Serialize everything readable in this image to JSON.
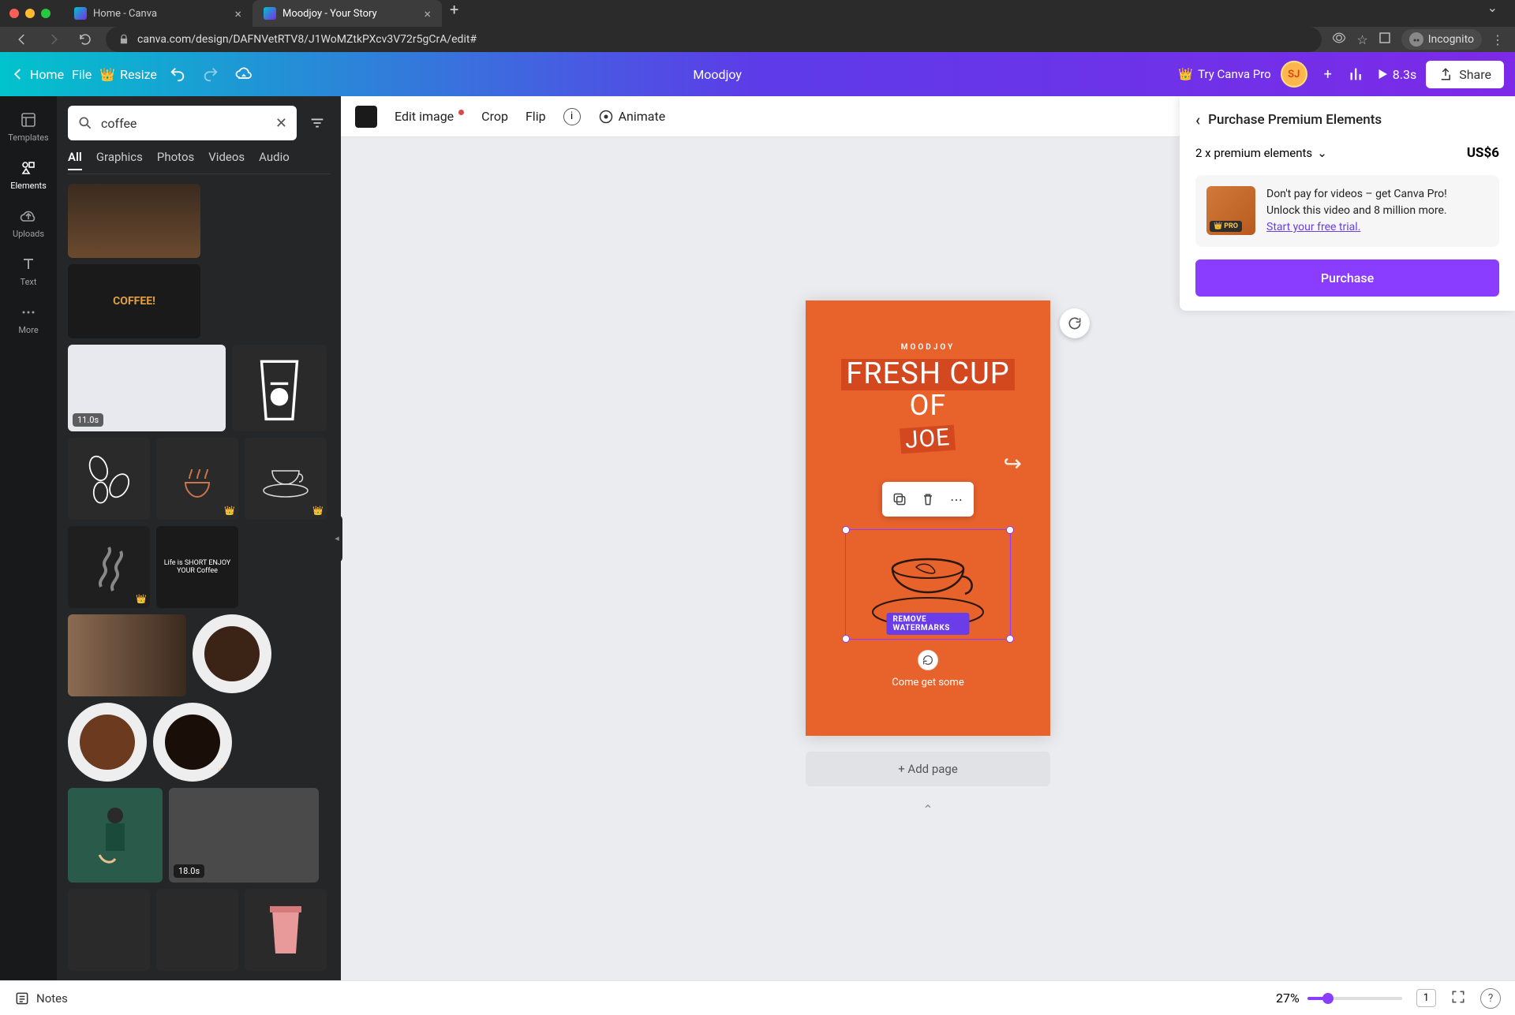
{
  "browser": {
    "tabs": [
      {
        "title": "Home - Canva",
        "active": false
      },
      {
        "title": "Moodjoy - Your Story",
        "active": true
      }
    ],
    "url": "canva.com/design/DAFNVetRTV8/J1WoMZtkPXcv3V72r5gCrA/edit#",
    "profile_label": "Incognito"
  },
  "topbar": {
    "home": "Home",
    "file": "File",
    "resize": "Resize",
    "project_name": "Moodjoy",
    "try_pro": "Try Canva Pro",
    "avatar_initials": "SJ",
    "duration": "8.3s",
    "share": "Share"
  },
  "siderail": {
    "templates": "Templates",
    "elements": "Elements",
    "uploads": "Uploads",
    "text": "Text",
    "more": "More"
  },
  "elements_panel": {
    "search_value": "coffee",
    "tabs": {
      "all": "All",
      "graphics": "Graphics",
      "photos": "Photos",
      "videos": "Videos",
      "audio": "Audio"
    },
    "results": [
      {
        "kind": "photo",
        "label": "latte-art-photo"
      },
      {
        "kind": "graphic",
        "label": "coffee-lettering",
        "text": "COFFEE!"
      },
      {
        "kind": "video",
        "label": "pouring-coffee-video",
        "duration": "11.0s"
      },
      {
        "kind": "graphic",
        "label": "takeaway-cup-outline"
      },
      {
        "kind": "graphic",
        "label": "coffee-beans-outline"
      },
      {
        "kind": "graphic",
        "label": "steaming-cup-line",
        "pro": true
      },
      {
        "kind": "graphic",
        "label": "cup-saucer-sketch",
        "pro": true
      },
      {
        "kind": "graphic",
        "label": "steam-graphic",
        "pro": true
      },
      {
        "kind": "graphic",
        "label": "life-short-coffee-quote"
      },
      {
        "kind": "photo",
        "label": "coffee-beans-photo"
      },
      {
        "kind": "photo",
        "label": "beans-in-cup-top"
      },
      {
        "kind": "photo",
        "label": "ground-coffee-cup-top"
      },
      {
        "kind": "photo",
        "label": "black-coffee-cup-top",
        "pro": true
      },
      {
        "kind": "graphic",
        "label": "person-pouring-coffee"
      },
      {
        "kind": "video",
        "label": "espresso-machine-video",
        "duration": "18.0s"
      },
      {
        "kind": "graphic",
        "label": "beans-outline-dark"
      },
      {
        "kind": "graphic",
        "label": "cup-outline-dark"
      },
      {
        "kind": "graphic",
        "label": "pink-takeaway-cup"
      }
    ]
  },
  "context_toolbar": {
    "edit_image": "Edit image",
    "crop": "Crop",
    "flip": "Flip",
    "animate": "Animate"
  },
  "canvas": {
    "brand": "MOODJOY",
    "headline_line1": "FRESH CUP",
    "headline_line2": "OF",
    "headline_line3": "JOE",
    "cta": "Come get some",
    "remove_watermarks": "REMOVE WATERMARKS",
    "add_page": "+ Add page"
  },
  "purchase_panel": {
    "title": "Purchase Premium Elements",
    "count_label": "2 x premium elements",
    "price": "US$6",
    "promo_line1": "Don't pay for videos – get Canva Pro!",
    "promo_line2": "Unlock this video and 8 million more.",
    "promo_link": "Start your free trial.",
    "promo_badge": "PRO",
    "purchase_btn": "Purchase"
  },
  "footer": {
    "notes": "Notes",
    "zoom_pct": "27%",
    "page_indicator": "1",
    "help": "?"
  }
}
